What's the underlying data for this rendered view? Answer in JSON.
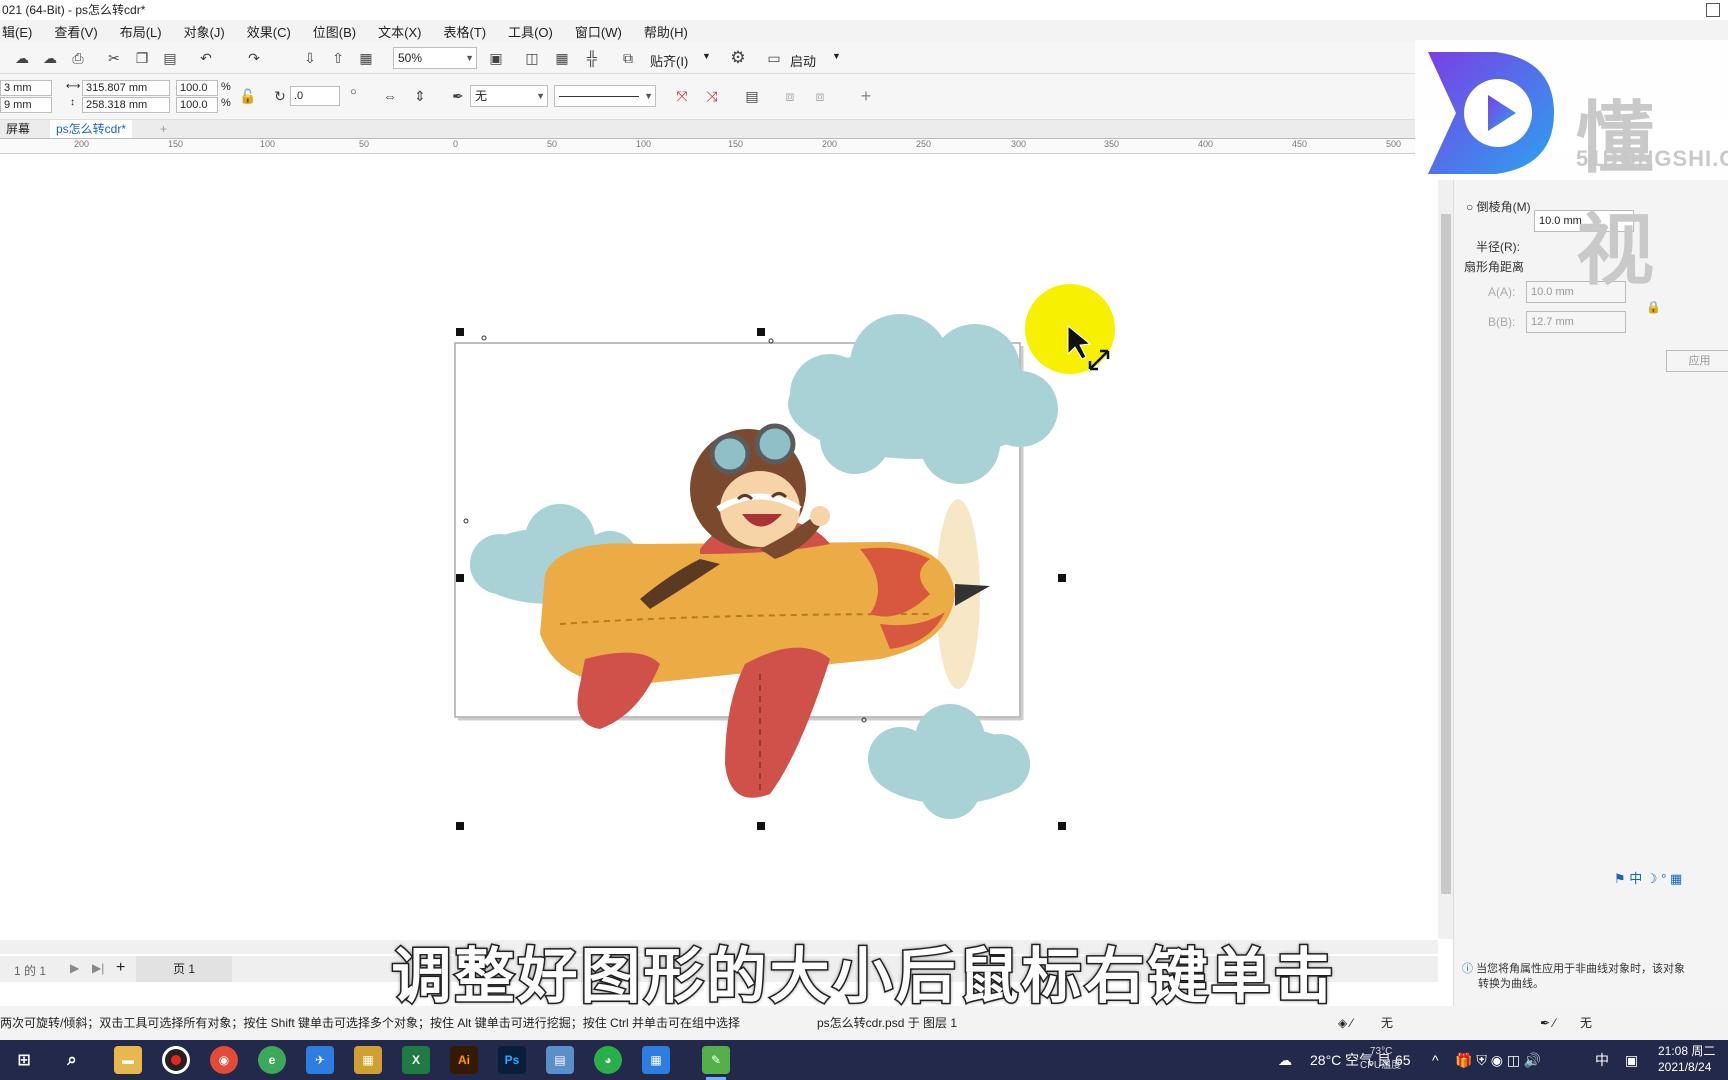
{
  "window": {
    "title": "021 (64-Bit) - ps怎么转cdr*"
  },
  "menu": [
    "辑(E)",
    "查看(V)",
    "布局(L)",
    "对象(J)",
    "效果(C)",
    "位图(B)",
    "文本(X)",
    "表格(T)",
    "工具(O)",
    "窗口(W)",
    "帮助(H)"
  ],
  "toolbar": {
    "zoom": "50%",
    "snap_label": "贴齐(I)",
    "launch_label": "启动",
    "pos_x": "3 mm",
    "pos_y": "9 mm",
    "width": "315.807 mm",
    "height": "258.318 mm",
    "scale_x": "100.0",
    "scale_y": "100.0",
    "percent": "%",
    "rotation": ".0",
    "outline": "无"
  },
  "tabs": {
    "left": "屏幕",
    "doc": "ps怎么转cdr*"
  },
  "ruler_ticks": [
    "200",
    "150",
    "100",
    "50",
    "0",
    "50",
    "100",
    "150",
    "200",
    "250",
    "300",
    "350",
    "400",
    "450",
    "500"
  ],
  "right_panel": {
    "chamfer": "倒棱角(M)",
    "radius_label": "半径(R):",
    "radius_value": "10.0 mm",
    "fan_label": "扇形角距离",
    "a_label": "A(A):",
    "a_value": "10.0 mm",
    "b_label": "B(B):",
    "b_value": "12.7 mm",
    "apply": "应用",
    "info": "当您将角属性应用于非曲线对象时，该对象",
    "info2": "转换为曲线。"
  },
  "logo": {
    "text": "懂视",
    "sub": "51DONGSHI.C"
  },
  "page_nav": {
    "counter": "1 的 1",
    "page_tab": "页 1"
  },
  "subtitle": "调整好图形的大小后鼠标右键单击",
  "status": {
    "hint": "两次可旋转/倾斜；双击工具可选择所有对象；按住 Shift 键单击可选择多个对象；按住 Alt 键单击可进行挖掘；按住 Ctrl 并单击可在组中选择",
    "object": "ps怎么转cdr.psd 于 图层 1",
    "fill": "无",
    "outline": "无"
  },
  "taskbar": {
    "weather": "28°C 空气 良 65",
    "cpu_top": "73°C",
    "cpu_bottom": "CPU温度",
    "ime": "中",
    "time": "21:08 周二",
    "date": "2021/8/24"
  },
  "colors": {
    "accent": "#1565c0",
    "taskbar": "#22294a",
    "highlight": "#f7f000"
  }
}
